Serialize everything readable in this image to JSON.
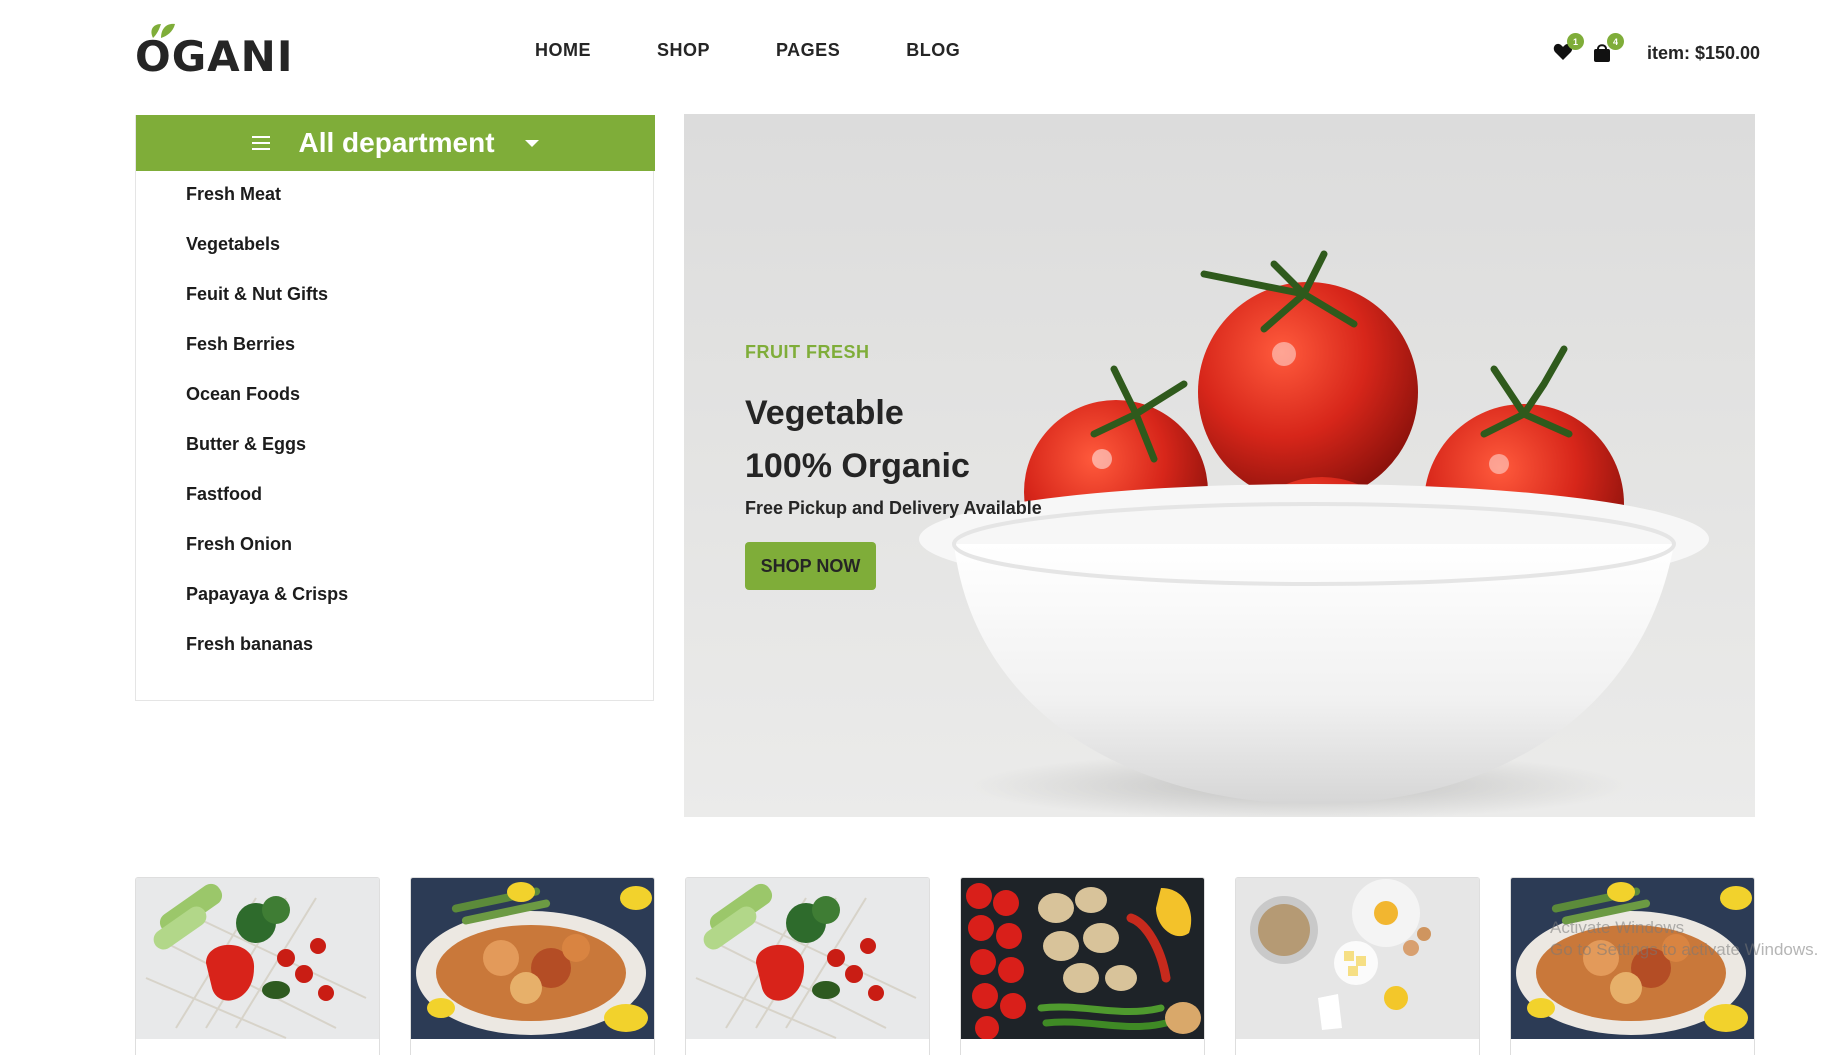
{
  "header": {
    "logo_text": "OGANI",
    "nav": [
      "HOME",
      "SHOP",
      "PAGES",
      "BLOG"
    ],
    "wishlist_count": "1",
    "cart_count": "4",
    "cart_total": "item: $150.00"
  },
  "departments": {
    "title": "All department",
    "items": [
      "Fresh Meat",
      "Vegetabels",
      "Feuit & Nut Gifts",
      "Fesh Berries",
      "Ocean Foods",
      "Butter & Eggs",
      "Fastfood",
      "Fresh Onion",
      "Papayaya & Crisps",
      "Fresh bananas"
    ]
  },
  "hero": {
    "eyebrow": "FRUIT FRESH",
    "title_line1": "Vegetable",
    "title_line2": "100% Organic",
    "subtitle": "Free Pickup and Delivery Available",
    "button": "SHOP NOW"
  },
  "categories": [
    {
      "image": "vegetables-in-net-bag"
    },
    {
      "image": "seafood-platter"
    },
    {
      "image": "vegetables-in-net-bag"
    },
    {
      "image": "tomatoes-mushrooms-peppers"
    },
    {
      "image": "baking-ingredients"
    },
    {
      "image": "seafood-platter"
    }
  ],
  "colors": {
    "accent": "#7fad39",
    "text": "#252525"
  },
  "overlay": {
    "watermark_line1": "Activate Windows",
    "watermark_line2": "Go to Settings to activate Windows."
  }
}
